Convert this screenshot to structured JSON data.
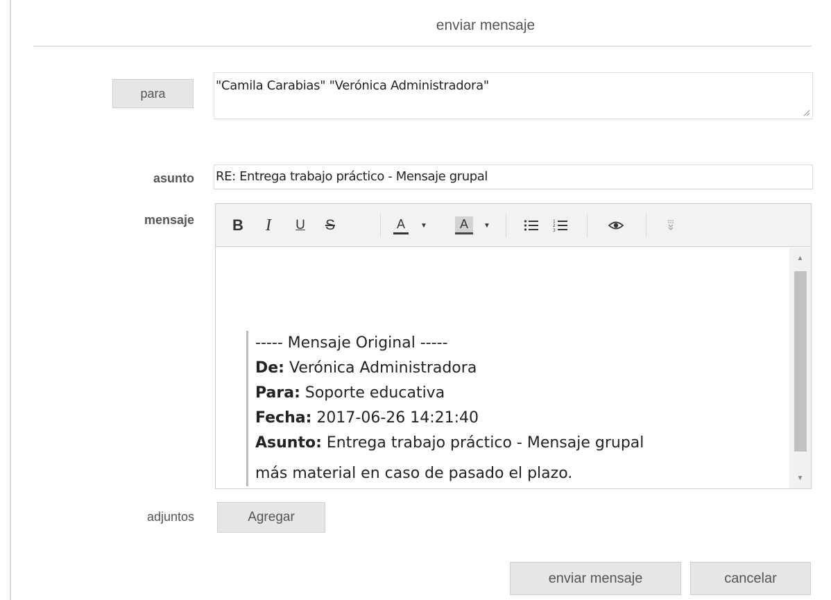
{
  "header": {
    "title": "enviar mensaje"
  },
  "to": {
    "button_label": "para",
    "value_part1": "\"Camila Carabias\" ",
    "value_part2": "\"Verónica Administradora\""
  },
  "subject": {
    "label": "asunto",
    "value": "RE: Entrega trabajo práctico - Mensaje grupal"
  },
  "message": {
    "label": "mensaje",
    "toolbar": {
      "bold": "B",
      "italic": "I",
      "underline": "U",
      "strike": "S",
      "text_color": "A",
      "bg_color": "A",
      "icons": [
        "bold-icon",
        "italic-icon",
        "underline-icon",
        "strikethrough-icon",
        "text-color-icon",
        "dropdown-caret-icon",
        "background-color-icon",
        "dropdown-caret-icon",
        "bullet-list-icon",
        "numbered-list-icon",
        "preview-eye-icon",
        "more-options-icon"
      ]
    },
    "quote": {
      "header": "----- Mensaje Original -----",
      "from_key": "De:",
      "from_value": " Verónica Administradora",
      "to_key": "Para:",
      "to_value": " Soporte educativa",
      "date_key": "Fecha:",
      "date_value": " 2017-06-26 14:21:40",
      "subject_key": "Asunto:",
      "subject_value": " Entrega trabajo práctico - Mensaje grupal",
      "cut_line": "más material en caso de pasado el plazo."
    }
  },
  "attachments": {
    "label": "adjuntos",
    "add_button": "Agregar"
  },
  "actions": {
    "send": "enviar mensaje",
    "cancel": "cancelar"
  },
  "colors": {
    "button_bg": "#e6e6e6",
    "border": "#cfcfcf",
    "text": "#555555",
    "content_text": "#222222"
  }
}
